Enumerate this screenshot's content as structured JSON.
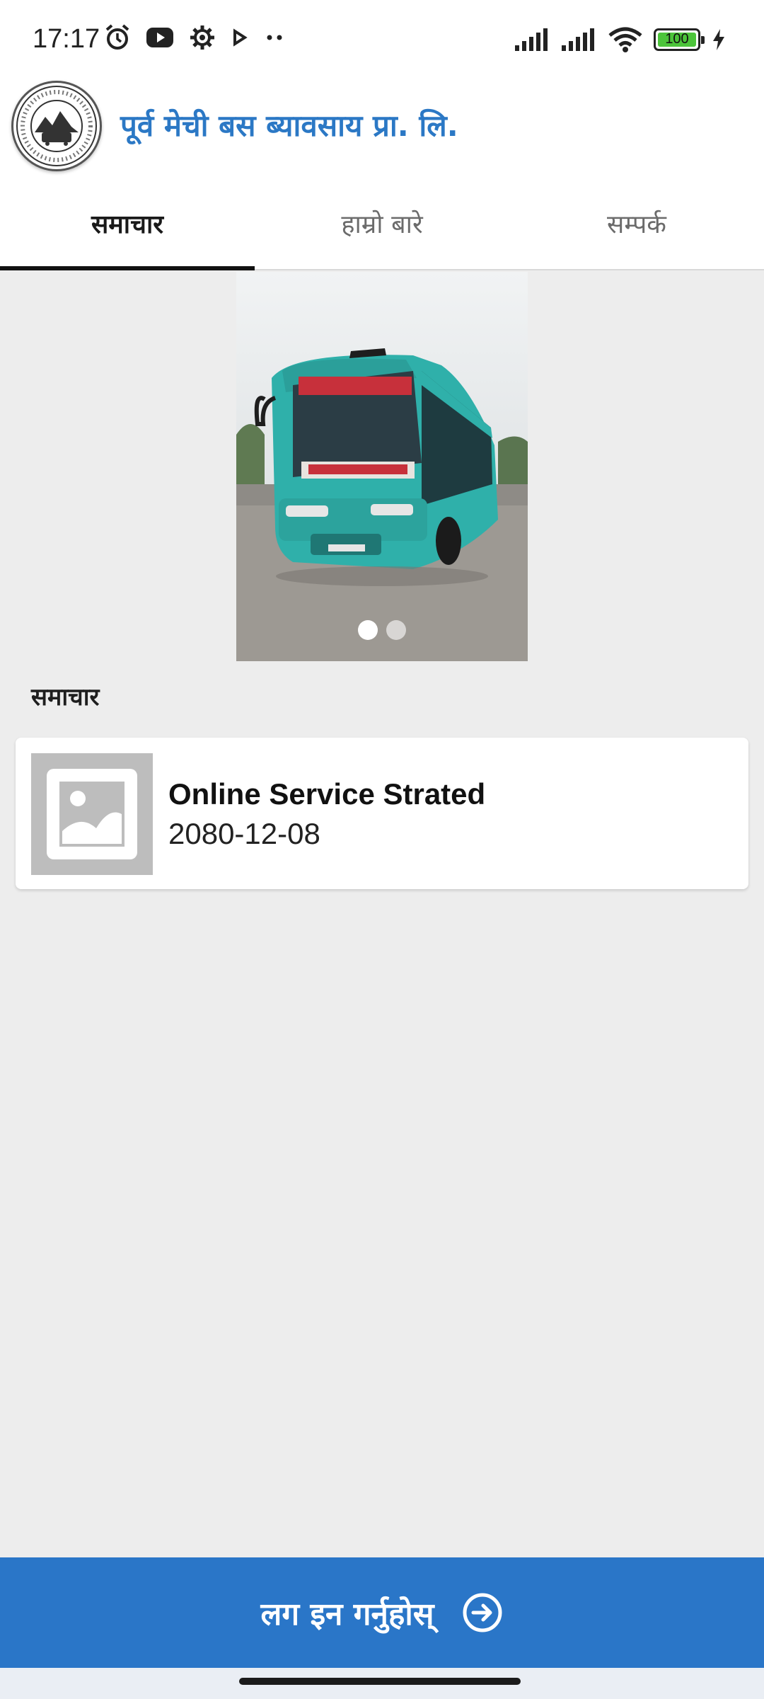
{
  "status_bar": {
    "time": "17:17",
    "battery": "100",
    "left_icons": [
      "alarm-icon",
      "youtube-icon",
      "settings-icon",
      "play-icon",
      "more-dots-icon"
    ],
    "right_icons": [
      "signal-icon",
      "signal-icon",
      "wifi-icon",
      "battery-icon",
      "charging-icon"
    ]
  },
  "header": {
    "title": "पूर्व मेची बस ब्यावसाय प्रा. लि.",
    "title_color": "#2b78c5"
  },
  "tabs": [
    {
      "label": "समाचार",
      "active": true
    },
    {
      "label": "हाम्रो बारे",
      "active": false
    },
    {
      "label": "सम्पर्क",
      "active": false
    }
  ],
  "carousel": {
    "slide_count": 2,
    "active_index": 0
  },
  "news": {
    "section_title": "समाचार",
    "items": [
      {
        "title": "Online Service Strated",
        "date": "2080-12-08"
      }
    ]
  },
  "login": {
    "label": "लग इन गर्नुहोस्",
    "background_color": "#2a76c8"
  }
}
